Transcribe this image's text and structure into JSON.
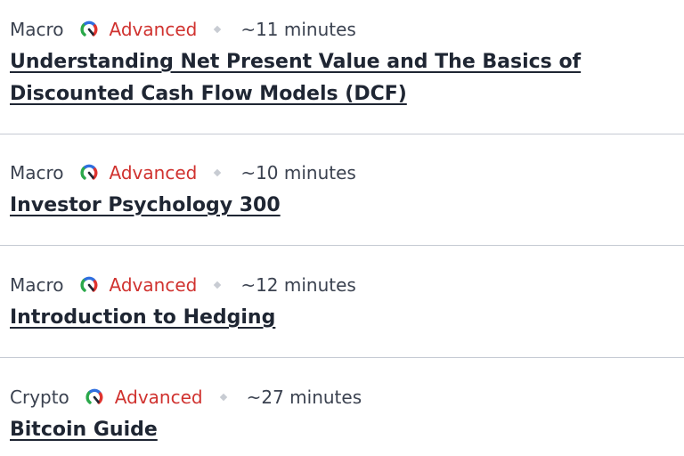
{
  "articles": [
    {
      "category": "Macro",
      "level": "Advanced",
      "level_icon": "gauge-advanced-icon",
      "duration": "~11 minutes",
      "title": "Understanding Net Present Value and The Basics of Discounted Cash Flow Models (DCF)"
    },
    {
      "category": "Macro",
      "level": "Advanced",
      "level_icon": "gauge-advanced-icon",
      "duration": "~10 minutes",
      "title": "Investor Psychology 300"
    },
    {
      "category": "Macro",
      "level": "Advanced",
      "level_icon": "gauge-advanced-icon",
      "duration": "~12 minutes",
      "title": "Introduction to Hedging"
    },
    {
      "category": "Crypto",
      "level": "Advanced",
      "level_icon": "gauge-advanced-icon",
      "duration": "~27 minutes",
      "title": "Bitcoin Guide"
    }
  ],
  "colors": {
    "level_text": "#d0322f",
    "gauge_red": "#e0342f",
    "gauge_green": "#2aa84a",
    "gauge_blue": "#2f6fe0",
    "divider": "#c5cad3"
  }
}
